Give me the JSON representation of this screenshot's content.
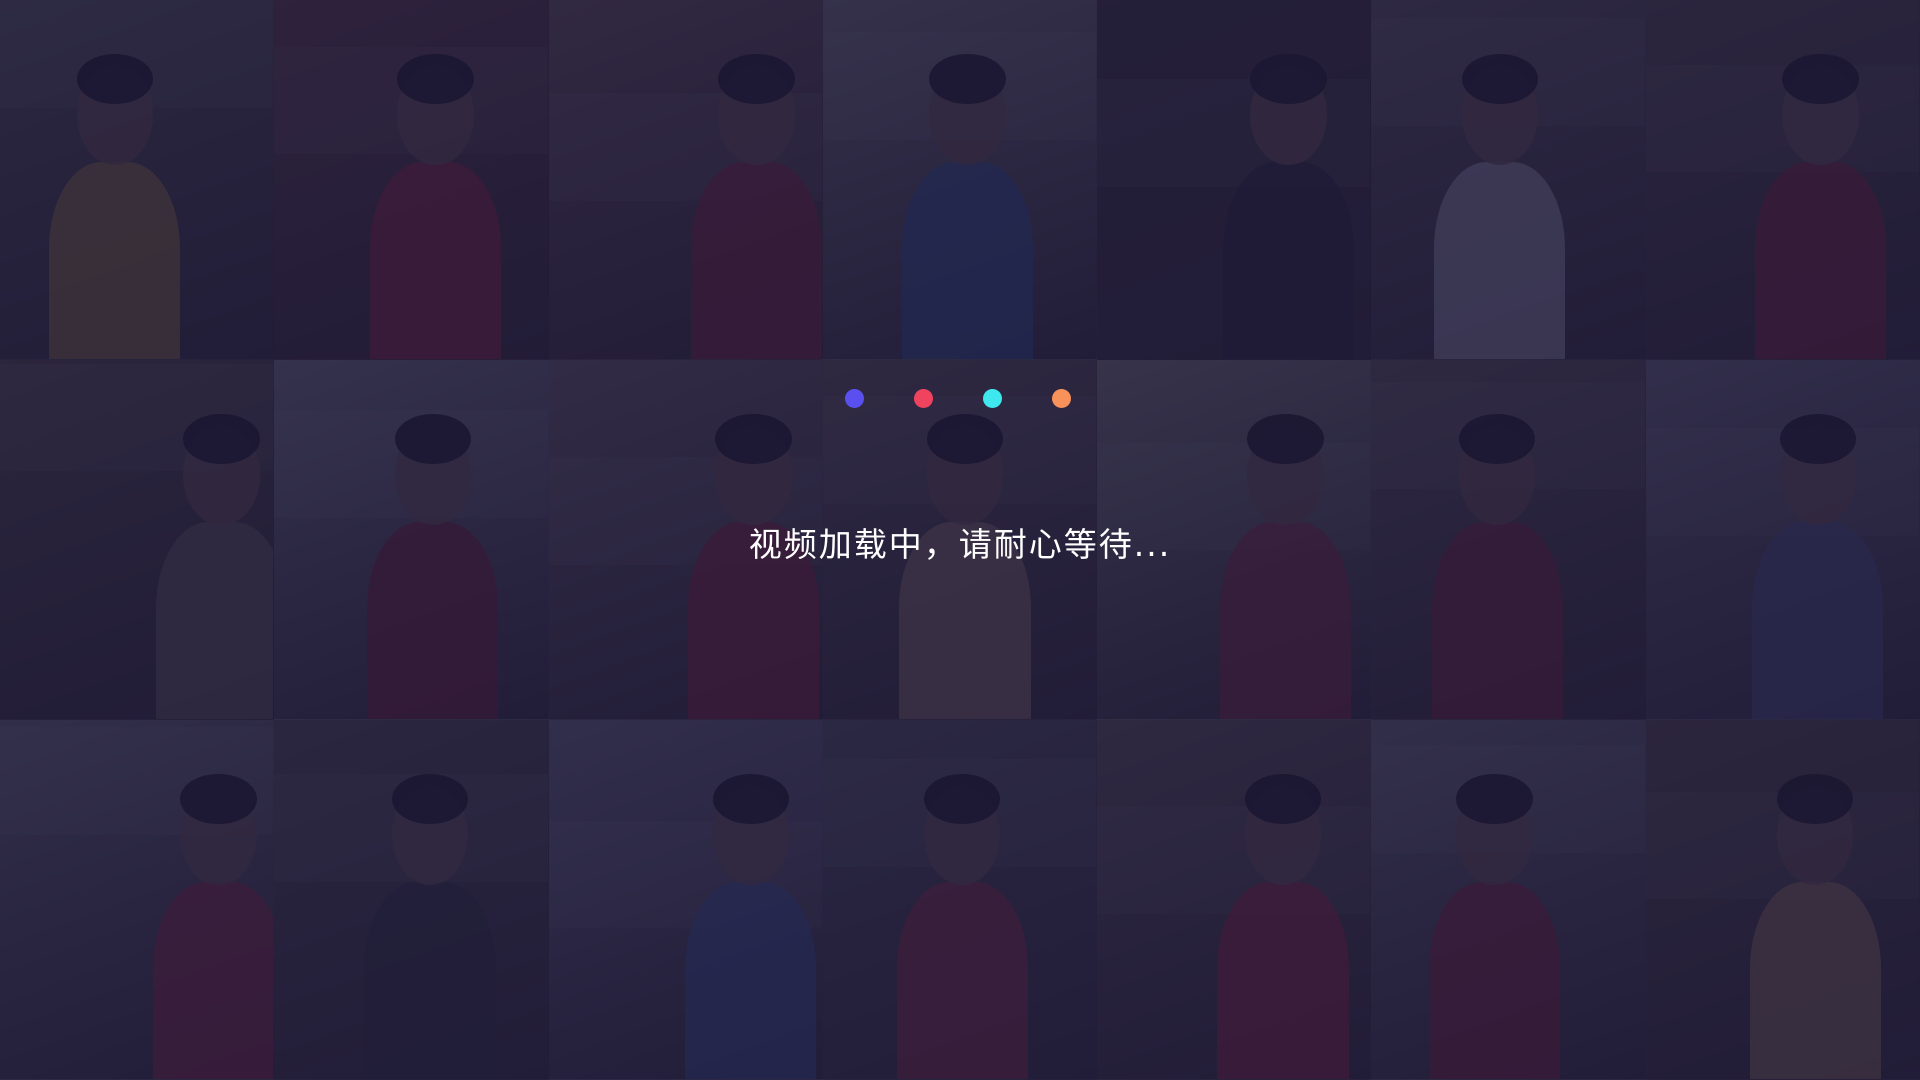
{
  "loader": {
    "message": "视频加载中，请耐心等待...",
    "dots": [
      {
        "name": "dot-blue",
        "color": "#5a50f0"
      },
      {
        "name": "dot-red",
        "color": "#f0435e"
      },
      {
        "name": "dot-cyan",
        "color": "#3fe8ee"
      },
      {
        "name": "dot-orange",
        "color": "#f7925a"
      }
    ]
  },
  "colors": {
    "background": "#1e1a38",
    "overlay": "rgba(28, 24, 58, 0.80)",
    "text": "#ffffff"
  },
  "background_grid": {
    "columns": 7,
    "rows": 3,
    "tiles": [
      {
        "name": "photo-tile-1",
        "base": "#6d6a60",
        "accent": "#c8a23a"
      },
      {
        "name": "photo-tile-2",
        "base": "#7a4a48",
        "accent": "#c8283a"
      },
      {
        "name": "photo-tile-3",
        "base": "#8a6a62",
        "accent": "#b0283a"
      },
      {
        "name": "photo-tile-4",
        "base": "#9a9690",
        "accent": "#3a6ab0"
      },
      {
        "name": "photo-tile-5",
        "base": "#4a3e38",
        "accent": "#2a2a2a"
      },
      {
        "name": "photo-tile-6",
        "base": "#7a6e68",
        "accent": "#d8d8e0"
      },
      {
        "name": "photo-tile-7",
        "base": "#6a5a50",
        "accent": "#b02838"
      },
      {
        "name": "photo-tile-8",
        "base": "#6a5a4a",
        "accent": "#8a7a68"
      },
      {
        "name": "photo-tile-9",
        "base": "#9a9a9a",
        "accent": "#a02030"
      },
      {
        "name": "photo-tile-10",
        "base": "#8a7a78",
        "accent": "#c02838"
      },
      {
        "name": "photo-tile-11",
        "base": "#7a6a60",
        "accent": "#c8a080"
      },
      {
        "name": "photo-tile-12",
        "base": "#a0a090",
        "accent": "#b03040"
      },
      {
        "name": "photo-tile-13",
        "base": "#7a6a60",
        "accent": "#a02838"
      },
      {
        "name": "photo-tile-14",
        "base": "#8a8890",
        "accent": "#5a6a9a"
      },
      {
        "name": "photo-tile-15",
        "base": "#8a8a8a",
        "accent": "#c03040"
      },
      {
        "name": "photo-tile-16",
        "base": "#6a625a",
        "accent": "#3a3a3a"
      },
      {
        "name": "photo-tile-17",
        "base": "#8a8a9a",
        "accent": "#4a6ab0"
      },
      {
        "name": "photo-tile-18",
        "base": "#6a6a6a",
        "accent": "#c03848"
      },
      {
        "name": "photo-tile-19",
        "base": "#7a6a60",
        "accent": "#c82838"
      },
      {
        "name": "photo-tile-20",
        "base": "#8a8a8a",
        "accent": "#b02838"
      },
      {
        "name": "photo-tile-21",
        "base": "#6a5a4a",
        "accent": "#c8a060"
      }
    ]
  }
}
